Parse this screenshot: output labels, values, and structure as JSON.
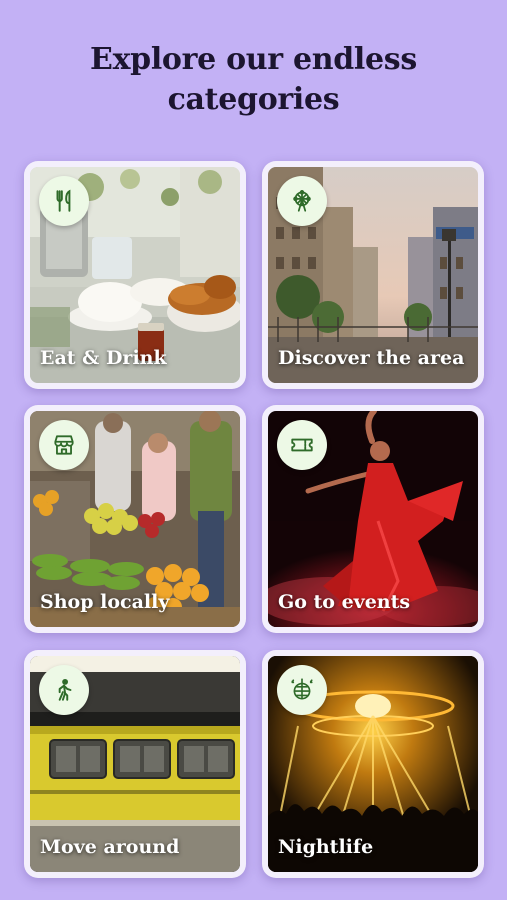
{
  "header": {
    "title_line1": "Explore our endless",
    "title_line2": "categories"
  },
  "colors": {
    "background": "#c3b1f5",
    "card_frame": "#f3effc",
    "badge_bg": "#edf9e6",
    "icon_green": "#2f6b2a"
  },
  "categories": [
    {
      "label": "Eat & Drink",
      "icon": "fork-knife-icon"
    },
    {
      "label": "Discover the area",
      "icon": "ferris-wheel-icon"
    },
    {
      "label": "Shop locally",
      "icon": "storefront-icon"
    },
    {
      "label": "Go to events",
      "icon": "ticket-icon"
    },
    {
      "label": "Move around",
      "icon": "walking-person-icon"
    },
    {
      "label": "Nightlife",
      "icon": "disco-ball-icon"
    }
  ]
}
